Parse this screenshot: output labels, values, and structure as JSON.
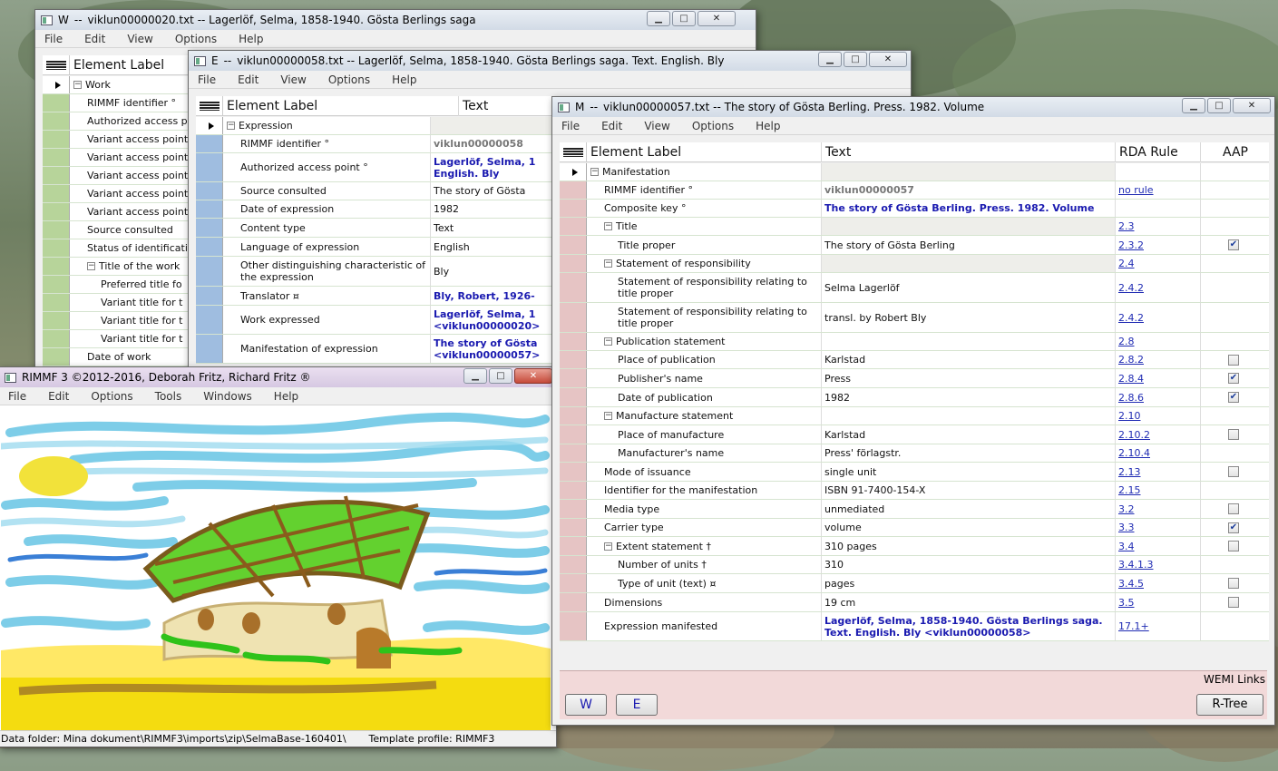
{
  "work_window": {
    "title_prefix": "W",
    "title": "viklun00000020.txt  --  Lagerlöf, Selma, 1858-1940. Gösta Berlings saga",
    "menu": [
      "File",
      "Edit",
      "View",
      "Options",
      "Help"
    ],
    "header": {
      "label": "Element Label"
    },
    "rows": [
      {
        "label": "Work",
        "indent": 0,
        "expander": "⊟",
        "current": true
      },
      {
        "label": "RIMMF identifier °",
        "indent": 1
      },
      {
        "label": "Authorized access p",
        "indent": 1
      },
      {
        "label": "Variant access point",
        "indent": 1
      },
      {
        "label": "Variant access point",
        "indent": 1
      },
      {
        "label": "Variant access point",
        "indent": 1
      },
      {
        "label": "Variant access point",
        "indent": 1
      },
      {
        "label": "Variant access point",
        "indent": 1
      },
      {
        "label": "Source consulted",
        "indent": 1
      },
      {
        "label": "Status of identificati",
        "indent": 1
      },
      {
        "label": "Title of the work",
        "indent": 1,
        "expander": "⊟"
      },
      {
        "label": "Preferred title fo",
        "indent": 2
      },
      {
        "label": "Variant title for t",
        "indent": 2
      },
      {
        "label": "Variant title for t",
        "indent": 2
      },
      {
        "label": "Variant title for t",
        "indent": 2
      },
      {
        "label": "Date of work",
        "indent": 1
      }
    ]
  },
  "expression_window": {
    "title_prefix": "E",
    "title": "viklun00000058.txt  --  Lagerlöf, Selma, 1858-1940. Gösta Berlings saga. Text. English. Bly",
    "menu": [
      "File",
      "Edit",
      "View",
      "Options",
      "Help"
    ],
    "header": {
      "label": "Element Label",
      "text": "Text"
    },
    "rows": [
      {
        "label": "Expression",
        "indent": 0,
        "expander": "⊟",
        "current": true,
        "text": "",
        "h": 20
      },
      {
        "label": "RIMMF identifier °",
        "indent": 1,
        "text": "viklun00000058",
        "style": "grey",
        "h": 20
      },
      {
        "label": "Authorized access point °",
        "indent": 1,
        "text": "Lagerlöf, Selma, 1 English. Bly",
        "style": "blue",
        "h": 32
      },
      {
        "label": "Source consulted",
        "indent": 1,
        "text": "The story of Gösta",
        "h": 20
      },
      {
        "label": "Date of expression",
        "indent": 1,
        "text": "1982",
        "h": 20
      },
      {
        "label": "Content type",
        "indent": 1,
        "text": "Text",
        "h": 21
      },
      {
        "label": "Language of expression",
        "indent": 1,
        "text": "English",
        "h": 21
      },
      {
        "label": "Other distinguishing characteristic of the expression",
        "indent": 1,
        "text": "Bly",
        "h": 33
      },
      {
        "label": "Translator ¤",
        "indent": 1,
        "text": "Bly, Robert, 1926-",
        "style": "blue",
        "h": 21
      },
      {
        "label": "Work expressed",
        "indent": 1,
        "text": "Lagerlöf, Selma, 1 <viklun00000020>",
        "style": "blue",
        "h": 32
      },
      {
        "label": "Manifestation of expression",
        "indent": 1,
        "text": "The story of Gösta <viklun00000057>",
        "style": "blue",
        "h": 32
      }
    ]
  },
  "rimmf_window": {
    "title": "RIMMF 3   ©2012-2016, Deborah Fritz, Richard Fritz ®",
    "menu": [
      "File",
      "Edit",
      "Options",
      "Tools",
      "Windows",
      "Help"
    ],
    "status_folder": "Data folder: Mina dokument\\RIMMF3\\imports\\zip\\SelmaBase-160401\\",
    "status_profile": "Template profile: RIMMF3"
  },
  "manifestation_window": {
    "title_prefix": "M",
    "title": "viklun00000057.txt  --  The story of Gösta Berling. Press. 1982. Volume",
    "menu": [
      "File",
      "Edit",
      "View",
      "Options",
      "Help"
    ],
    "header": {
      "label": "Element Label",
      "text": "Text",
      "rule": "RDA Rule",
      "aap": "AAP"
    },
    "rows": [
      {
        "label": "Manifestation",
        "indent": 0,
        "expander": "⊟",
        "current": true,
        "text": "",
        "rule": "",
        "aap": "none",
        "shade": true,
        "h": 20
      },
      {
        "label": "RIMMF identifier °",
        "indent": 1,
        "text": "viklun00000057",
        "style": "grey",
        "rule": "no rule",
        "aap": "none",
        "h": 20
      },
      {
        "label": "Composite key °",
        "indent": 1,
        "text": "The story of Gösta Berling. Press. 1982. Volume",
        "style": "blue",
        "rule": "",
        "aap": "none",
        "h": 20
      },
      {
        "label": "Title",
        "indent": 1,
        "expander": "⊟",
        "text": "",
        "rule": "2.3",
        "aap": "none",
        "shade": true,
        "h": 20
      },
      {
        "label": "Title proper",
        "indent": 2,
        "text": "The story of Gösta Berling",
        "rule": "2.3.2",
        "aap": "checked",
        "h": 21
      },
      {
        "label": "Statement of responsibility",
        "indent": 1,
        "expander": "⊟",
        "text": "",
        "rule": "2.4",
        "aap": "none",
        "shade": true,
        "h": 20
      },
      {
        "label": "Statement of responsibility relating to title proper",
        "indent": 2,
        "text": "Selma Lagerlöf",
        "rule": "2.4.2",
        "aap": "none",
        "h": 33
      },
      {
        "label": "Statement of responsibility relating to title proper",
        "indent": 2,
        "text": "transl. by Robert Bly",
        "rule": "2.4.2",
        "aap": "none",
        "h": 33
      },
      {
        "label": "Publication statement",
        "indent": 1,
        "expander": "⊟",
        "text": "",
        "rule": "2.8",
        "aap": "none",
        "h": 20
      },
      {
        "label": "Place of publication",
        "indent": 2,
        "text": "Karlstad",
        "rule": "2.8.2",
        "aap": "unchecked",
        "h": 20
      },
      {
        "label": "Publisher's name",
        "indent": 2,
        "text": "Press",
        "rule": "2.8.4",
        "aap": "checked",
        "h": 21
      },
      {
        "label": "Date of publication",
        "indent": 2,
        "text": "1982",
        "rule": "2.8.6",
        "aap": "checked",
        "h": 21
      },
      {
        "label": "Manufacture statement",
        "indent": 1,
        "expander": "⊟",
        "text": "",
        "rule": "2.10",
        "aap": "none",
        "h": 20
      },
      {
        "label": "Place of manufacture",
        "indent": 2,
        "text": "Karlstad",
        "rule": "2.10.2",
        "aap": "unchecked",
        "h": 21
      },
      {
        "label": "Manufacturer's name",
        "indent": 2,
        "text": "Press' förlagstr.",
        "rule": "2.10.4",
        "aap": "none",
        "h": 20
      },
      {
        "label": "Mode of issuance",
        "indent": 1,
        "text": "single unit",
        "rule": "2.13",
        "aap": "unchecked",
        "h": 21
      },
      {
        "label": "Identifier for the manifestation",
        "indent": 1,
        "text": "ISBN 91-7400-154-X",
        "rule": "2.15",
        "aap": "none",
        "h": 20
      },
      {
        "label": "Media type",
        "indent": 1,
        "text": "unmediated",
        "rule": "3.2",
        "aap": "unchecked",
        "h": 21
      },
      {
        "label": "Carrier type",
        "indent": 1,
        "text": "volume",
        "rule": "3.3",
        "aap": "checked",
        "h": 20
      },
      {
        "label": "Extent statement †",
        "indent": 1,
        "expander": "⊟",
        "text": "310 pages",
        "rule": "3.4",
        "aap": "unchecked",
        "h": 21
      },
      {
        "label": "Number of units †",
        "indent": 2,
        "text": "310",
        "rule": "3.4.1.3",
        "aap": "none",
        "h": 20
      },
      {
        "label": "Type of unit (text) ¤",
        "indent": 2,
        "text": "pages",
        "rule": "3.4.5",
        "aap": "unchecked",
        "h": 21
      },
      {
        "label": "Dimensions",
        "indent": 1,
        "text": "19 cm",
        "rule": "3.5",
        "aap": "unchecked",
        "h": 21
      },
      {
        "label": "Expression manifested",
        "indent": 1,
        "text": "Lagerlöf, Selma, 1858-1940. Gösta Berlings saga. Text. English. Bly <viklun00000058>",
        "style": "blue",
        "rule": "17.1+",
        "aap": "none",
        "h": 32
      }
    ],
    "wemi_label": "WEMI Links",
    "w_button": "W",
    "e_button": "E",
    "rtree_button": "R-Tree"
  },
  "colors": {
    "work_selector": "#b7d49a",
    "expression_selector": "#9fbde0",
    "manifestation_selector": "#e6c4c4",
    "manifestation_footer": "#f2d9d9",
    "link_blue": "#1f2bb3"
  }
}
